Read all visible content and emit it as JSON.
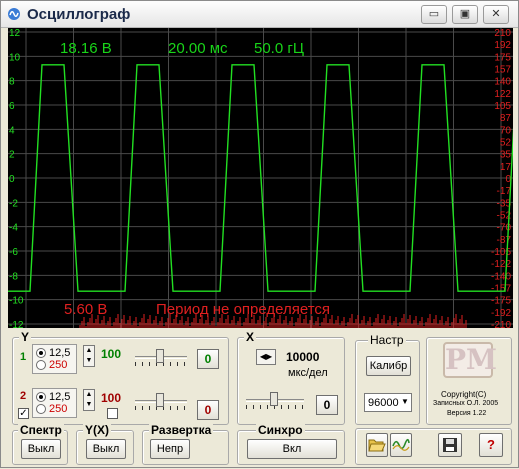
{
  "window": {
    "title": "Осциллограф"
  },
  "titlebar": {
    "minimize_icon": "▭",
    "maximize_icon": "▣",
    "close_icon": "✕"
  },
  "scope": {
    "voltage": "18.16 В",
    "time": "20.00 мс",
    "freq": "50.0 гЦ",
    "bottom_value": "5.60 В",
    "period_msg": "Период не определяется",
    "left_scale": [
      "12",
      "10",
      "8",
      "6",
      "4",
      "2",
      "0",
      "-2",
      "-4",
      "-6",
      "-8",
      "-10",
      "-12"
    ],
    "right_scale": [
      "210",
      "192",
      "175",
      "157",
      "140",
      "122",
      "105",
      "87",
      "70",
      "52",
      "35",
      "17",
      "0",
      "-17",
      "-35",
      "-52",
      "-70",
      "-87",
      "-105",
      "-122",
      "-140",
      "-157",
      "-175",
      "-192",
      "-210"
    ],
    "colors": {
      "trace": "#22e022",
      "grid": "#4a4a4a",
      "left_axis": "#22e022",
      "right_axis": "#e02020",
      "noise": "#e02020"
    }
  },
  "y_group": {
    "label": "Y",
    "ch1": {
      "number": "1",
      "radio_a": "12,5",
      "radio_b": "250",
      "gain": "100",
      "button": "0",
      "color": "#008000"
    },
    "ch2": {
      "number": "2",
      "radio_a": "12,5",
      "radio_b": "250",
      "gain": "100",
      "button": "0",
      "color": "#a00000",
      "checked": "✓"
    }
  },
  "x_group": {
    "label": "X",
    "value": "10000",
    "unit": "мкс/дел",
    "button": "0"
  },
  "nastr_group": {
    "label": "Настр",
    "calib_button": "Калибр",
    "rate_value": "96000"
  },
  "logo": {
    "text": "PM",
    "copyright": "Copyright(C)",
    "author": "Записных О.Л. 2005",
    "version": "Версия 1.22"
  },
  "spectr_group": {
    "label": "Спектр",
    "button": "Выкл"
  },
  "yx_group": {
    "label": "Y(X)",
    "button": "Выкл"
  },
  "sweep_group": {
    "label": "Развертка",
    "button": "Непр"
  },
  "sync_group": {
    "label": "Синхро",
    "button": "Вкл"
  },
  "tools": {
    "open_icon": "folder-open",
    "wave_icon": "wave",
    "save_icon": "floppy",
    "help_label": "?"
  }
}
